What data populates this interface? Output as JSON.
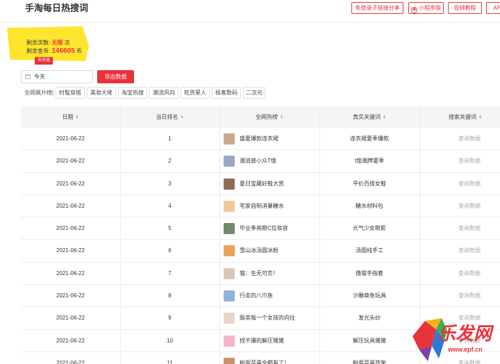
{
  "header": {
    "title": "手淘每日热搜词",
    "buttons": [
      {
        "label": "免登录子链接分享"
      },
      {
        "label": "小程序版",
        "icon": "mini-program-icon"
      },
      {
        "label": "视频教程"
      },
      {
        "label": "AP"
      }
    ]
  },
  "balance": {
    "count_label": "剩余次数: ",
    "count_value": "无限",
    "count_unit": " 次",
    "coin_label": "剩余金币: ",
    "coin_value": "146605",
    "coin_unit": " 币",
    "recharge_label": "去充值"
  },
  "filter": {
    "date_value": "今天",
    "export_label": "导出数据"
  },
  "tags": {
    "label": "全网飙升榜|",
    "items": [
      "时髦穿搭",
      "美妆大佬",
      "淘宝热搜",
      "潮流风向",
      "吃货星人",
      "极客数码",
      "二次元"
    ]
  },
  "table": {
    "columns": [
      "日期",
      "当日排名",
      "全网热榜",
      "真实关键词",
      "搜索关键词"
    ],
    "query_label": "查询数据",
    "rows": [
      {
        "date": "2021-06-22",
        "rank": "1",
        "hot": "盛夏爆款连衣裙",
        "keyword": "连衣裙夏季爆款"
      },
      {
        "date": "2021-06-22",
        "rank": "2",
        "hot": "潮流感小众T恤",
        "keyword": "t恤潮牌夏季"
      },
      {
        "date": "2021-06-22",
        "rank": "3",
        "hot": "夏日宝藏好鞋大赏",
        "keyword": "平价百搭女鞋"
      },
      {
        "date": "2021-06-22",
        "rank": "4",
        "hot": "宅家自制消暑糖水",
        "keyword": "糖水材料包"
      },
      {
        "date": "2021-06-22",
        "rank": "5",
        "hot": "毕业季亮眼C位妆容",
        "keyword": "元气少女眼影"
      },
      {
        "date": "2021-06-22",
        "rank": "6",
        "hot": "雪山冰汤圆冰粉",
        "keyword": "汤圆纯手工"
      },
      {
        "date": "2021-06-22",
        "rank": "7",
        "hot": "猫：生无可恋！",
        "keyword": "撸猫手指套"
      },
      {
        "date": "2021-06-22",
        "rank": "8",
        "hot": "行走的八爪鱼",
        "keyword": "沙雕章鱼玩具"
      },
      {
        "date": "2021-06-22",
        "rank": "9",
        "hot": "贩卖每一个女孩的向往",
        "keyword": "发光头纱"
      },
      {
        "date": "2021-06-22",
        "rank": "10",
        "hot": "捏不爆的解压猪猪",
        "keyword": "解压玩具猪猪"
      },
      {
        "date": "2021-06-22",
        "rank": "11",
        "hot": "粉面菜蛋全都有了！",
        "keyword": "粉面菜蛋货架"
      }
    ]
  },
  "watermark": {
    "text": "乐发网",
    "url": "www.epf.cn"
  },
  "colors": {
    "accent": "#e8323c",
    "card": "#ffe52e"
  }
}
